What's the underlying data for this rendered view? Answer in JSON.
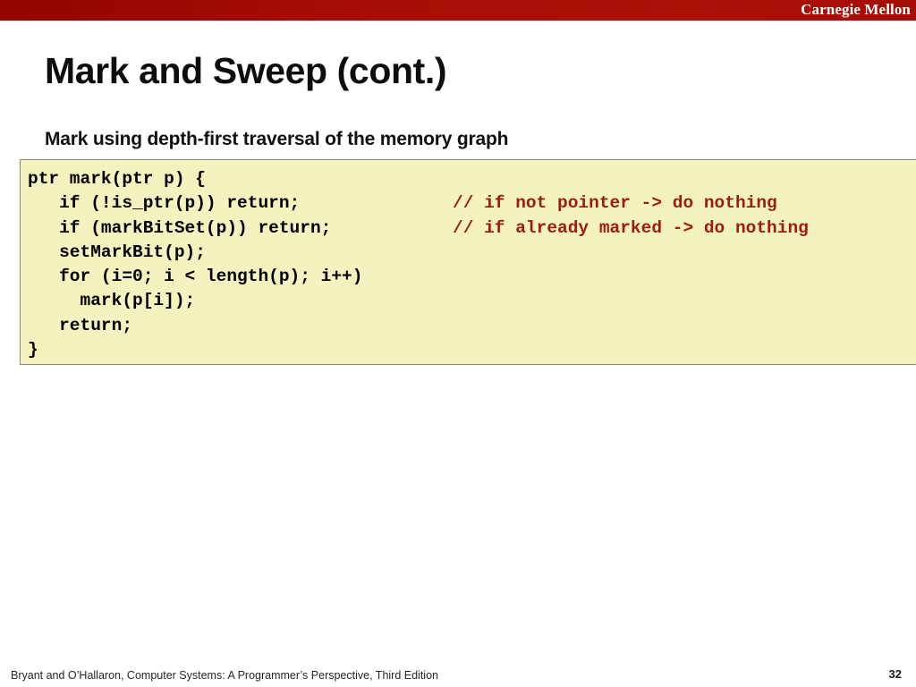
{
  "banner": {
    "brand": "Carnegie Mellon",
    "background_color": "#a50c03",
    "text_color": "#ffffff"
  },
  "slide": {
    "title": "Mark and Sweep (cont.)",
    "subtitle": "Mark using depth-first traversal of the memory graph"
  },
  "code_block": {
    "background_color": "#f4f2be",
    "text_color": "#000000",
    "comment_color": "#9e1b14",
    "language": "C",
    "lines": [
      {
        "code": "ptr mark(ptr p) {",
        "comment": ""
      },
      {
        "code": "   if (!is_ptr(p)) return;",
        "comment": "// if not pointer -> do nothing"
      },
      {
        "code": "   if (markBitSet(p)) return;",
        "comment": "// if already marked -> do nothing"
      },
      {
        "code": "   setMarkBit(p);",
        "comment": ""
      },
      {
        "code": "   for (i=0; i < length(p); i++)",
        "comment": ""
      },
      {
        "code": "     mark(p[i]);",
        "comment": ""
      },
      {
        "code": "   return;",
        "comment": ""
      },
      {
        "code": "}",
        "comment": ""
      }
    ]
  },
  "footer": {
    "citation": "Bryant and O’Hallaron, Computer Systems: A Programmer’s Perspective, Third Edition",
    "page_number": "32"
  }
}
